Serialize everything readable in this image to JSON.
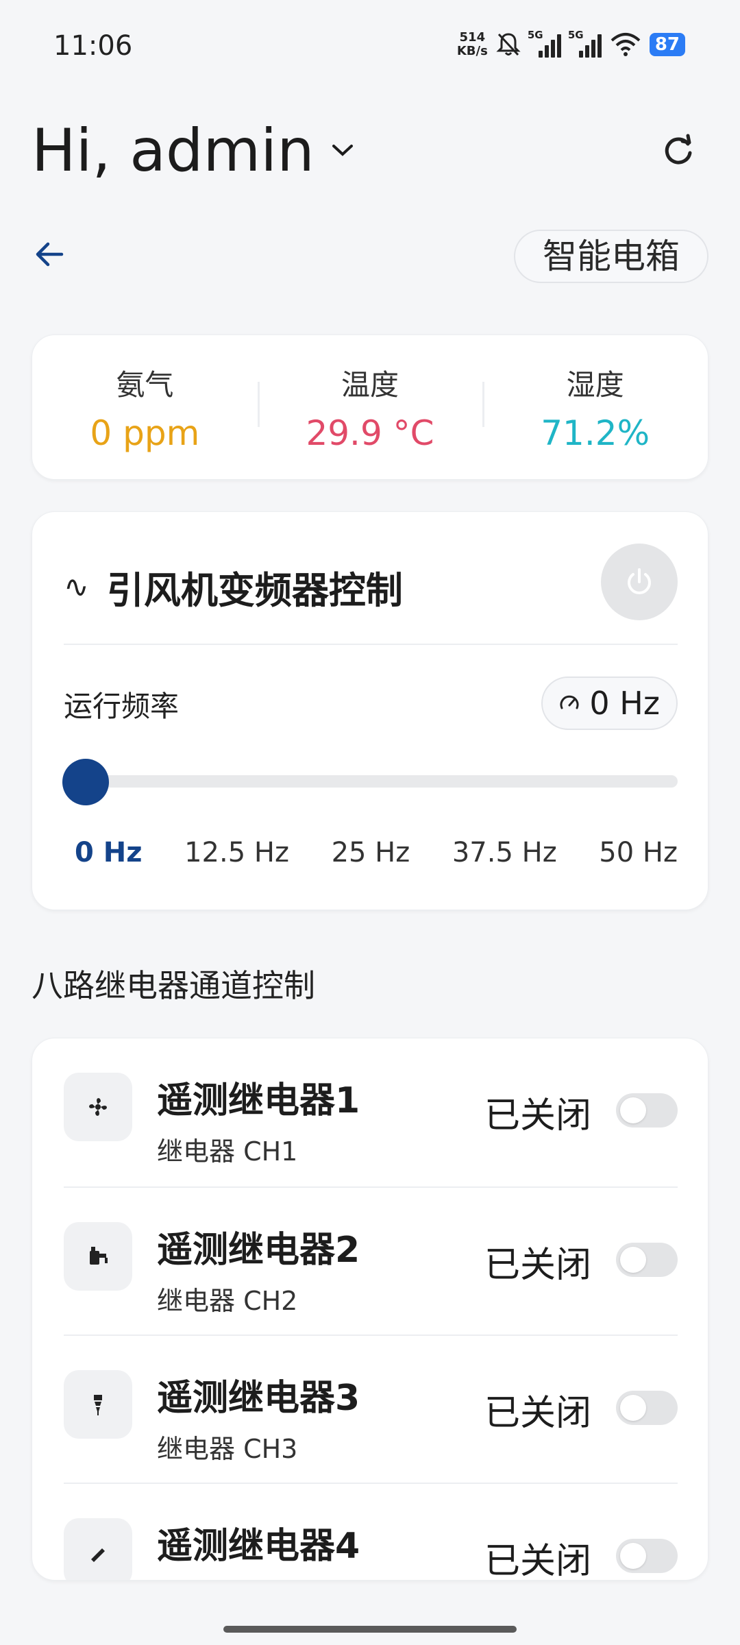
{
  "status_bar": {
    "time": "11:06",
    "net_speed_value": "514",
    "net_speed_unit": "KB/s",
    "signal1_label": "5G",
    "signal2_label": "5G",
    "battery": "87"
  },
  "header": {
    "greeting": "Hi, admin",
    "tag": "智能电箱"
  },
  "sensors": [
    {
      "label": "氨气",
      "value": "0 ppm",
      "color": "#e8a317"
    },
    {
      "label": "温度",
      "value": "29.9 °C",
      "color": "#e14a68"
    },
    {
      "label": "湿度",
      "value": "71.2%",
      "color": "#1fb5c6"
    }
  ],
  "inverter": {
    "icon": "wave-icon",
    "title": "引风机变频器控制",
    "freq_label": "运行频率",
    "freq_value": "0 Hz",
    "slider_value_hz": 0,
    "slider_max_hz": 50,
    "ticks": [
      "0 Hz",
      "12.5 Hz",
      "25 Hz",
      "37.5 Hz",
      "50 Hz"
    ]
  },
  "relay_section": {
    "title": "八路继电器通道控制"
  },
  "relays": [
    {
      "name": "遥测继电器1",
      "channel": "继电器 CH1",
      "state": "已关闭",
      "icon": "fan-icon",
      "on": false
    },
    {
      "name": "遥测继电器2",
      "channel": "继电器 CH2",
      "state": "已关闭",
      "icon": "pump-icon",
      "on": false
    },
    {
      "name": "遥测继电器3",
      "channel": "继电器 CH3",
      "state": "已关闭",
      "icon": "drill-icon",
      "on": false
    },
    {
      "name": "遥测继电器4",
      "channel": "",
      "state": "已关闭",
      "icon": "tool-icon",
      "on": false
    }
  ],
  "colors": {
    "accent": "#14438a",
    "background": "#f5f6f8"
  }
}
